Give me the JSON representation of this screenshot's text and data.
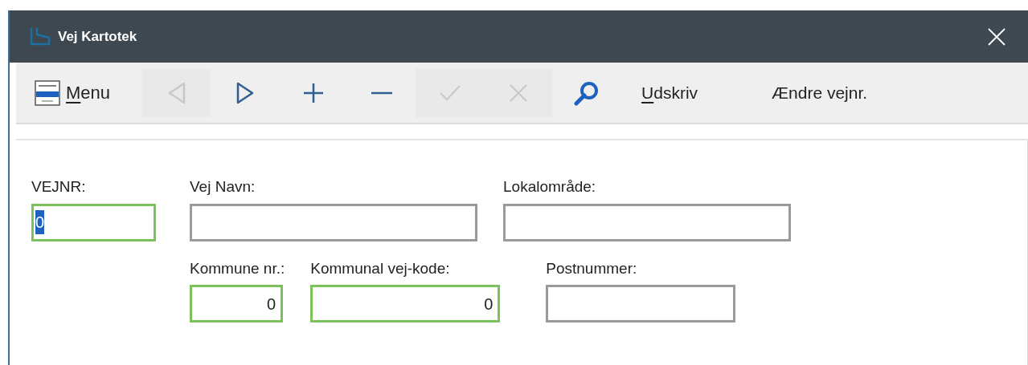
{
  "window": {
    "title": "Vej Kartotek"
  },
  "toolbar": [
    {
      "kind": "menu",
      "mnemonic": "M",
      "rest": "enu",
      "disabled": false
    },
    {
      "kind": "prev",
      "disabled": true
    },
    {
      "kind": "next",
      "disabled": false
    },
    {
      "kind": "add",
      "disabled": false
    },
    {
      "kind": "remove",
      "disabled": false
    },
    {
      "kind": "confirm",
      "disabled": true
    },
    {
      "kind": "cancel",
      "disabled": true
    },
    {
      "kind": "search",
      "disabled": false
    },
    {
      "kind": "text",
      "mnemonic": "U",
      "rest": "dskriv",
      "disabled": false
    },
    {
      "kind": "text",
      "rest": "Ændre vejnr.",
      "disabled": false
    }
  ],
  "form": {
    "rows": [
      [
        {
          "label": "VEJNR:",
          "value": "0",
          "kind": "code",
          "required": true,
          "text_selected": true
        },
        {
          "label": "Vej Navn:",
          "kind": "wide",
          "required": false
        },
        {
          "label": "Lokalområde:",
          "kind": "wide",
          "required": false
        }
      ],
      [
        "",
        {
          "label": "Kommune nr.:",
          "value": "0",
          "kind": "number",
          "required": true
        },
        {
          "label": "Kommunal vej-kode:",
          "value": "0",
          "kind": "number-wide",
          "required": true
        },
        {
          "label": "Postnummer:",
          "kind": "medium",
          "required": false
        }
      ]
    ]
  }
}
